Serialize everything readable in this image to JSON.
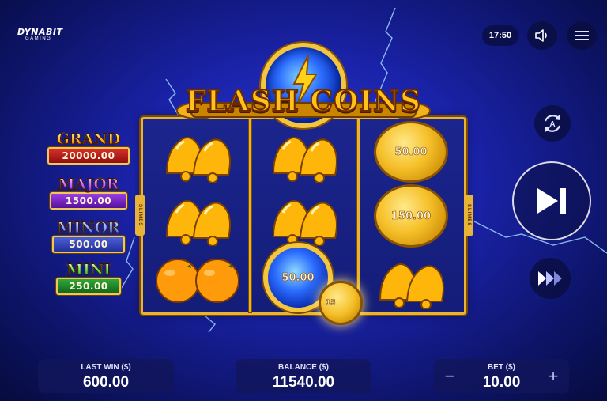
{
  "logo": {
    "brand": "DYNABIT",
    "sub": "GAMING"
  },
  "topbar": {
    "clock": "17:50",
    "sound_icon": "speaker-icon",
    "menu_icon": "hamburger-icon"
  },
  "title": "FLASH COINS",
  "jackpots": [
    {
      "name": "GRAND",
      "value": "20000.00"
    },
    {
      "name": "MAJOR",
      "value": "1500.00"
    },
    {
      "name": "MINOR",
      "value": "500.00"
    },
    {
      "name": "MINI",
      "value": "250.00"
    }
  ],
  "side_tag": "SLIMES",
  "reels": {
    "coins": [
      "50.00",
      "150.00",
      "50.00",
      "15"
    ]
  },
  "controls": {
    "autoplay_icon": "autoplay-icon",
    "spin_icon": "play-skip-icon",
    "turbo_icon": "fast-forward-icon"
  },
  "bottom": {
    "last_win_label": "LAST WIN ($)",
    "last_win_value": "600.00",
    "balance_label": "BALANCE ($)",
    "balance_value": "11540.00",
    "bet_label": "BET ($)",
    "bet_value": "10.00",
    "minus": "−",
    "plus": "+"
  },
  "colors": {
    "gold": "#e8b437",
    "background": "#1a22a8",
    "grand": "#ffae14",
    "major": "#c25bff",
    "minor": "#6f9bff",
    "mini": "#5ddc3a"
  }
}
